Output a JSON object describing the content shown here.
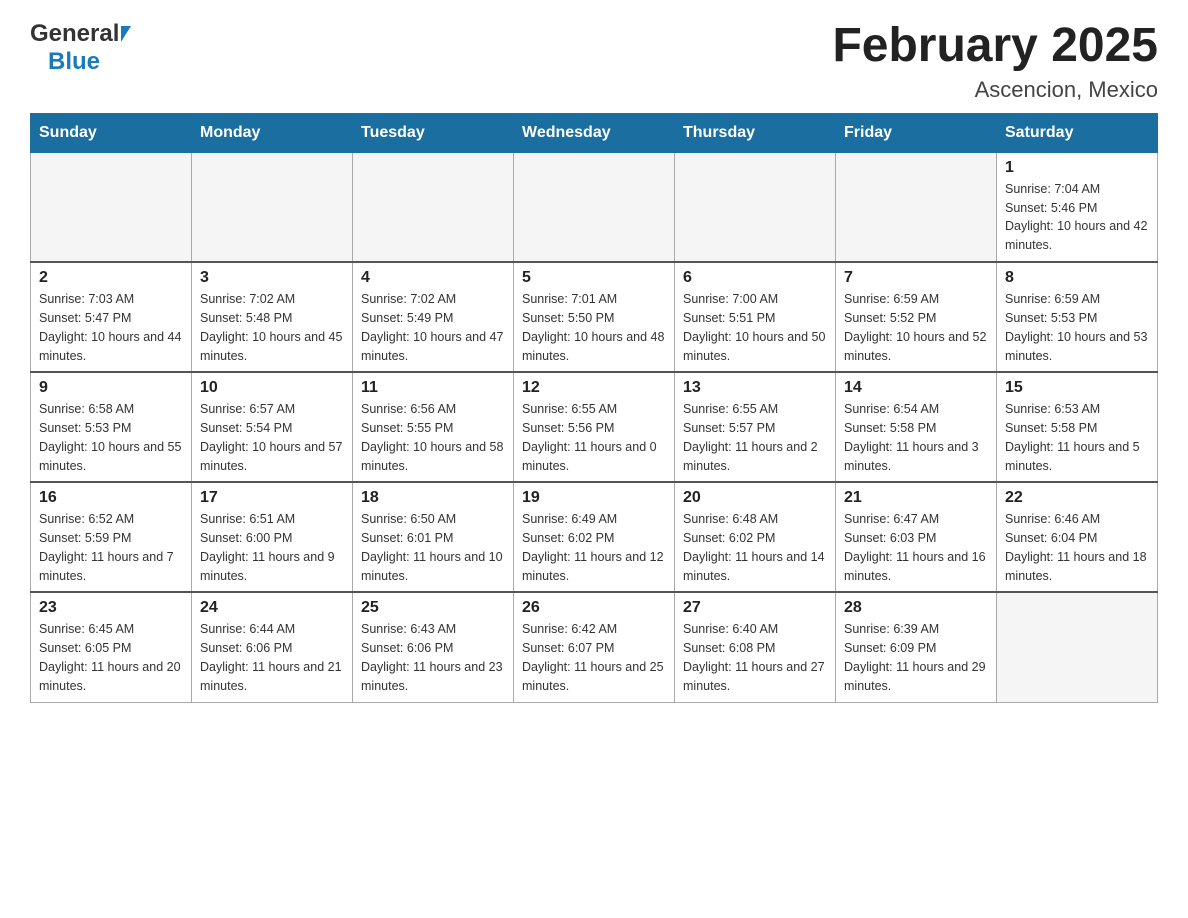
{
  "header": {
    "logo_general": "General",
    "logo_blue": "Blue",
    "month_title": "February 2025",
    "location": "Ascencion, Mexico"
  },
  "weekdays": [
    "Sunday",
    "Monday",
    "Tuesday",
    "Wednesday",
    "Thursday",
    "Friday",
    "Saturday"
  ],
  "weeks": [
    [
      {
        "day": "",
        "sunrise": "",
        "sunset": "",
        "daylight": ""
      },
      {
        "day": "",
        "sunrise": "",
        "sunset": "",
        "daylight": ""
      },
      {
        "day": "",
        "sunrise": "",
        "sunset": "",
        "daylight": ""
      },
      {
        "day": "",
        "sunrise": "",
        "sunset": "",
        "daylight": ""
      },
      {
        "day": "",
        "sunrise": "",
        "sunset": "",
        "daylight": ""
      },
      {
        "day": "",
        "sunrise": "",
        "sunset": "",
        "daylight": ""
      },
      {
        "day": "1",
        "sunrise": "Sunrise: 7:04 AM",
        "sunset": "Sunset: 5:46 PM",
        "daylight": "Daylight: 10 hours and 42 minutes."
      }
    ],
    [
      {
        "day": "2",
        "sunrise": "Sunrise: 7:03 AM",
        "sunset": "Sunset: 5:47 PM",
        "daylight": "Daylight: 10 hours and 44 minutes."
      },
      {
        "day": "3",
        "sunrise": "Sunrise: 7:02 AM",
        "sunset": "Sunset: 5:48 PM",
        "daylight": "Daylight: 10 hours and 45 minutes."
      },
      {
        "day": "4",
        "sunrise": "Sunrise: 7:02 AM",
        "sunset": "Sunset: 5:49 PM",
        "daylight": "Daylight: 10 hours and 47 minutes."
      },
      {
        "day": "5",
        "sunrise": "Sunrise: 7:01 AM",
        "sunset": "Sunset: 5:50 PM",
        "daylight": "Daylight: 10 hours and 48 minutes."
      },
      {
        "day": "6",
        "sunrise": "Sunrise: 7:00 AM",
        "sunset": "Sunset: 5:51 PM",
        "daylight": "Daylight: 10 hours and 50 minutes."
      },
      {
        "day": "7",
        "sunrise": "Sunrise: 6:59 AM",
        "sunset": "Sunset: 5:52 PM",
        "daylight": "Daylight: 10 hours and 52 minutes."
      },
      {
        "day": "8",
        "sunrise": "Sunrise: 6:59 AM",
        "sunset": "Sunset: 5:53 PM",
        "daylight": "Daylight: 10 hours and 53 minutes."
      }
    ],
    [
      {
        "day": "9",
        "sunrise": "Sunrise: 6:58 AM",
        "sunset": "Sunset: 5:53 PM",
        "daylight": "Daylight: 10 hours and 55 minutes."
      },
      {
        "day": "10",
        "sunrise": "Sunrise: 6:57 AM",
        "sunset": "Sunset: 5:54 PM",
        "daylight": "Daylight: 10 hours and 57 minutes."
      },
      {
        "day": "11",
        "sunrise": "Sunrise: 6:56 AM",
        "sunset": "Sunset: 5:55 PM",
        "daylight": "Daylight: 10 hours and 58 minutes."
      },
      {
        "day": "12",
        "sunrise": "Sunrise: 6:55 AM",
        "sunset": "Sunset: 5:56 PM",
        "daylight": "Daylight: 11 hours and 0 minutes."
      },
      {
        "day": "13",
        "sunrise": "Sunrise: 6:55 AM",
        "sunset": "Sunset: 5:57 PM",
        "daylight": "Daylight: 11 hours and 2 minutes."
      },
      {
        "day": "14",
        "sunrise": "Sunrise: 6:54 AM",
        "sunset": "Sunset: 5:58 PM",
        "daylight": "Daylight: 11 hours and 3 minutes."
      },
      {
        "day": "15",
        "sunrise": "Sunrise: 6:53 AM",
        "sunset": "Sunset: 5:58 PM",
        "daylight": "Daylight: 11 hours and 5 minutes."
      }
    ],
    [
      {
        "day": "16",
        "sunrise": "Sunrise: 6:52 AM",
        "sunset": "Sunset: 5:59 PM",
        "daylight": "Daylight: 11 hours and 7 minutes."
      },
      {
        "day": "17",
        "sunrise": "Sunrise: 6:51 AM",
        "sunset": "Sunset: 6:00 PM",
        "daylight": "Daylight: 11 hours and 9 minutes."
      },
      {
        "day": "18",
        "sunrise": "Sunrise: 6:50 AM",
        "sunset": "Sunset: 6:01 PM",
        "daylight": "Daylight: 11 hours and 10 minutes."
      },
      {
        "day": "19",
        "sunrise": "Sunrise: 6:49 AM",
        "sunset": "Sunset: 6:02 PM",
        "daylight": "Daylight: 11 hours and 12 minutes."
      },
      {
        "day": "20",
        "sunrise": "Sunrise: 6:48 AM",
        "sunset": "Sunset: 6:02 PM",
        "daylight": "Daylight: 11 hours and 14 minutes."
      },
      {
        "day": "21",
        "sunrise": "Sunrise: 6:47 AM",
        "sunset": "Sunset: 6:03 PM",
        "daylight": "Daylight: 11 hours and 16 minutes."
      },
      {
        "day": "22",
        "sunrise": "Sunrise: 6:46 AM",
        "sunset": "Sunset: 6:04 PM",
        "daylight": "Daylight: 11 hours and 18 minutes."
      }
    ],
    [
      {
        "day": "23",
        "sunrise": "Sunrise: 6:45 AM",
        "sunset": "Sunset: 6:05 PM",
        "daylight": "Daylight: 11 hours and 20 minutes."
      },
      {
        "day": "24",
        "sunrise": "Sunrise: 6:44 AM",
        "sunset": "Sunset: 6:06 PM",
        "daylight": "Daylight: 11 hours and 21 minutes."
      },
      {
        "day": "25",
        "sunrise": "Sunrise: 6:43 AM",
        "sunset": "Sunset: 6:06 PM",
        "daylight": "Daylight: 11 hours and 23 minutes."
      },
      {
        "day": "26",
        "sunrise": "Sunrise: 6:42 AM",
        "sunset": "Sunset: 6:07 PM",
        "daylight": "Daylight: 11 hours and 25 minutes."
      },
      {
        "day": "27",
        "sunrise": "Sunrise: 6:40 AM",
        "sunset": "Sunset: 6:08 PM",
        "daylight": "Daylight: 11 hours and 27 minutes."
      },
      {
        "day": "28",
        "sunrise": "Sunrise: 6:39 AM",
        "sunset": "Sunset: 6:09 PM",
        "daylight": "Daylight: 11 hours and 29 minutes."
      },
      {
        "day": "",
        "sunrise": "",
        "sunset": "",
        "daylight": ""
      }
    ]
  ]
}
